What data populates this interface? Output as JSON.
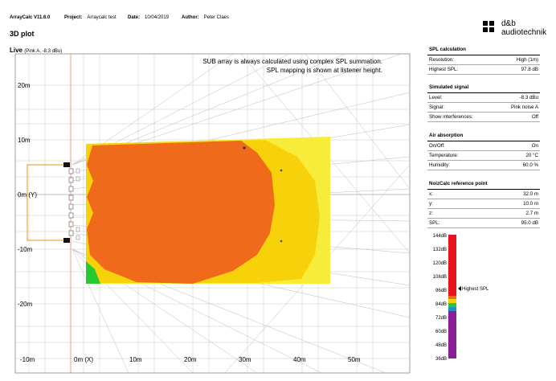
{
  "header": {
    "app_label": "ArrayCalc V11.6.0",
    "project_label": "Project:",
    "project": "Arraycalc test",
    "date_label": "Date:",
    "date": "10/04/2019",
    "author_label": "Author:",
    "author": "Peter Claes"
  },
  "page_title": "3D plot",
  "logo": {
    "line1": "d&b",
    "line2": "audiotechnik"
  },
  "plot": {
    "title": "Live",
    "subtitle": "(Pink A, -8.3 dBu)",
    "note_line1": "SUB array is always calculated using complex SPL summation.",
    "note_line2": "SPL mapping is shown at listener height.",
    "y_ticks": [
      "20m",
      "10m",
      "0m (Y)",
      "-10m",
      "-20m"
    ],
    "x_ticks": [
      "-10m",
      "0m (X)",
      "10m",
      "20m",
      "30m",
      "40m",
      "50m"
    ]
  },
  "spl_calculation": {
    "title": "SPL calculation",
    "rows": [
      {
        "label": "Resolution:",
        "value": "High (1m)"
      },
      {
        "label": "Highest SPL:",
        "value": "97.8 dB"
      }
    ]
  },
  "simulated_signal": {
    "title": "Simulated signal",
    "rows": [
      {
        "label": "Level:",
        "value": "-8.3 dBu"
      },
      {
        "label": "Signal:",
        "value": "Pink noise A"
      },
      {
        "label": "Show interferences:",
        "value": "Off"
      }
    ]
  },
  "air_absorption": {
    "title": "Air absorption",
    "rows": [
      {
        "label": "On/Off:",
        "value": "On"
      },
      {
        "label": "Temperature:",
        "value": "20 °C"
      },
      {
        "label": "Humidity:",
        "value": "60.0 %"
      }
    ]
  },
  "noizcalc": {
    "title": "NoizCalc reference point",
    "rows": [
      {
        "label": "x:",
        "value": "32.0 m"
      },
      {
        "label": "y:",
        "value": "10.0 m"
      },
      {
        "label": "z:",
        "value": "2.7 m"
      },
      {
        "label": "SPL:",
        "value": "95.0 dB"
      }
    ]
  },
  "scale": {
    "labels": [
      "144dB",
      "132dB",
      "120dB",
      "108dB",
      "96dB",
      "84dB",
      "72dB",
      "60dB",
      "48dB",
      "36dB"
    ],
    "highest_label": "Highest SPL"
  },
  "colors": {
    "orange": "#f06a1c",
    "yellow": "#f7d20a",
    "light_yellow": "#f8ec3a",
    "green": "#28c832",
    "red": "#e8161c",
    "purple": "#8a1e98",
    "grid": "#c8c8c8",
    "stage": "#e69a1a"
  }
}
